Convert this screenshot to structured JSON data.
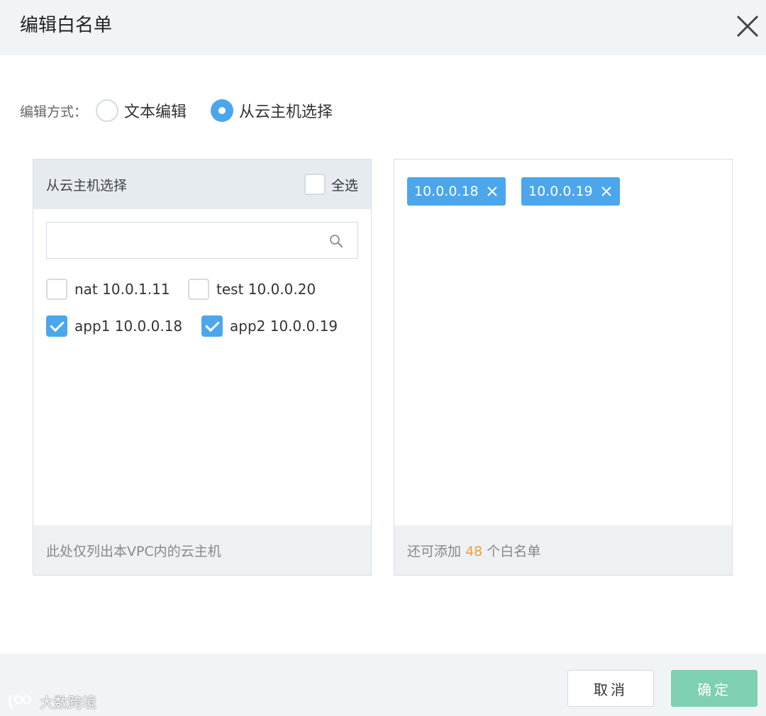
{
  "dialog": {
    "title": "编辑白名单"
  },
  "mode": {
    "label": "编辑方式：",
    "options": [
      {
        "label": "文本编辑",
        "selected": false
      },
      {
        "label": "从云主机选择",
        "selected": true
      }
    ]
  },
  "left_panel": {
    "title": "从云主机选择",
    "select_all_label": "全选",
    "select_all_checked": false,
    "search_placeholder": "",
    "vms": [
      {
        "label": "nat 10.0.1.11",
        "checked": false
      },
      {
        "label": "test 10.0.0.20",
        "checked": false
      },
      {
        "label": "app1 10.0.0.18",
        "checked": true
      },
      {
        "label": "app2 10.0.0.19",
        "checked": true
      }
    ],
    "footer_note": "此处仅列出本VPC内的云主机"
  },
  "right_panel": {
    "tags": [
      "10.0.0.18",
      "10.0.0.19"
    ],
    "footer_prefix": "还可添加",
    "footer_count": "48",
    "footer_suffix": "个白名单"
  },
  "buttons": {
    "cancel": "取消",
    "ok": "确定"
  },
  "watermark": "大数跨境",
  "colors": {
    "accent": "#4ba6ec",
    "ok_button": "#7ed0b0",
    "count_highlight": "#f0a033"
  }
}
